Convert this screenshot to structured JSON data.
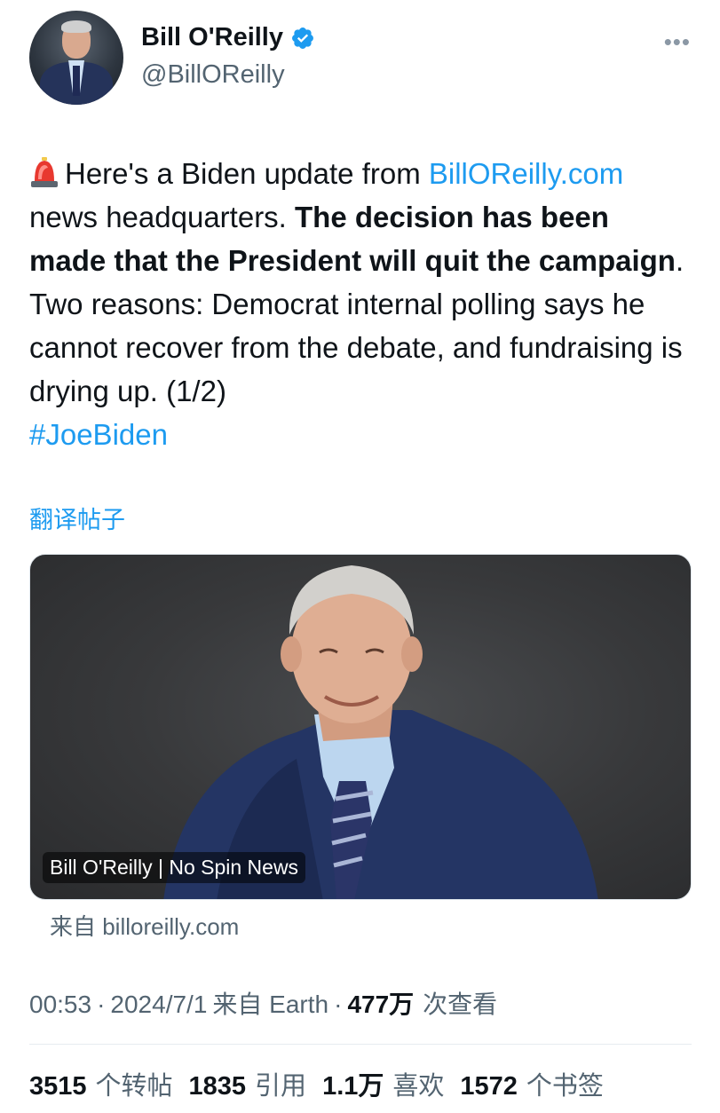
{
  "author": {
    "display_name": "Bill O'Reilly",
    "handle": "@BillOReilly",
    "verified_icon": "verified-badge-icon",
    "verified_color": "#1d9bf0"
  },
  "more_icon": "more-options-icon",
  "tweet": {
    "siren_icon": "police-light-emoji",
    "text_1": "Here's a Biden update from ",
    "link": "BillOReilly.com",
    "text_2": " news headquarters.  ",
    "bold": "The decision has been made that the President will quit the campaign",
    "text_3": ".  Two reasons: Democrat internal polling says he cannot recover from the debate, and fundraising is drying up. (1/2)",
    "hashtag": "#JoeBiden"
  },
  "translate_label": "翻译帖子",
  "media": {
    "caption": "Bill O'Reilly | No Spin News"
  },
  "source_label": "来自 billoreilly.com",
  "meta": {
    "time": "00:53",
    "date": "2024/7/1",
    "via": "来自 Earth",
    "views_count": "477万",
    "views_label": "次查看",
    "separator": "·"
  },
  "stats": {
    "reposts_count": "3515",
    "reposts_label": "个转帖",
    "quotes_count": "1835",
    "quotes_label": "引用",
    "likes_count": "1.1万",
    "likes_label": "喜欢",
    "bookmarks_count": "1572",
    "bookmarks_label": "个书签"
  },
  "colors": {
    "link": "#1d9bf0",
    "text": "#0f1419",
    "secondary": "#536471"
  }
}
